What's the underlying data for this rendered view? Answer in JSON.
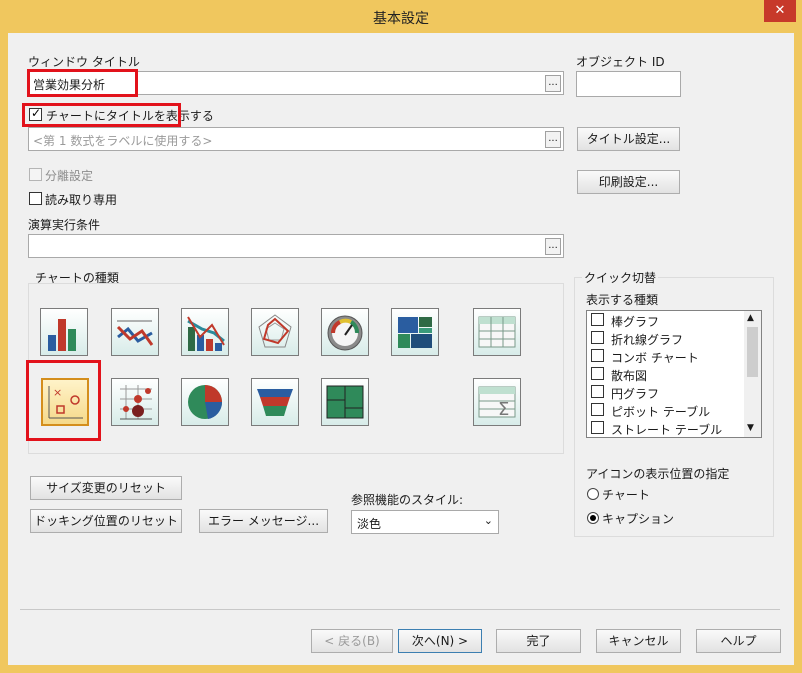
{
  "window": {
    "title": "基本設定",
    "close": "✕"
  },
  "window_title": {
    "label": "ウィンドウ タイトル",
    "value": "営業効果分析",
    "browse": "..."
  },
  "object_id": {
    "label": "オブジェクト ID",
    "value": ""
  },
  "show_title": {
    "label": "チャートにタイトルを表示する",
    "checked": true
  },
  "label_expr": {
    "placeholder": "<第 1 数式をラベルに使用する>",
    "browse": "..."
  },
  "buttons": {
    "title_settings": "タイトル設定...",
    "print_settings": "印刷設定...",
    "reset_size": "サイズ変更のリセット",
    "reset_docking": "ドッキング位置のリセット",
    "error_messages": "エラー メッセージ...",
    "back": "< 戻る(B)",
    "next": "次へ(N) >",
    "finish": "完了",
    "cancel": "キャンセル",
    "help": "ヘルプ"
  },
  "detach": {
    "label": "分離設定",
    "checked": false,
    "disabled": true
  },
  "read_only": {
    "label": "読み取り専用",
    "checked": false
  },
  "calc_condition": {
    "label": "演算実行条件",
    "value": "",
    "browse": "..."
  },
  "chart_types": {
    "label": "チャートの種類",
    "icons": [
      "bar-chart-icon",
      "line-chart-icon",
      "combo-chart-icon",
      "radar-chart-icon",
      "gauge-chart-icon",
      "block-chart-icon",
      "pivot-table-icon",
      "scatter-chart-icon",
      "grid-chart-icon",
      "pie-chart-icon",
      "funnel-chart-icon",
      "mekko-chart-icon",
      "straight-table-icon"
    ],
    "selected": "scatter-chart-icon"
  },
  "quick_switch": {
    "group_label": "クイック切替",
    "list_label": "表示する種類",
    "items": [
      "棒グラフ",
      "折れ線グラフ",
      "コンボ チャート",
      "散布図",
      "円グラフ",
      "ピボット テーブル",
      "ストレート テーブル"
    ]
  },
  "icon_position": {
    "label": "アイコンの表示位置の指定",
    "options": [
      "チャート",
      "キャプション"
    ],
    "selected": "キャプション"
  },
  "style": {
    "label": "参照機能のスタイル:",
    "value": "淡色"
  },
  "colors": {
    "frame": "#f0c75e",
    "close": "#c7392a",
    "highlight": "#e2121b"
  }
}
